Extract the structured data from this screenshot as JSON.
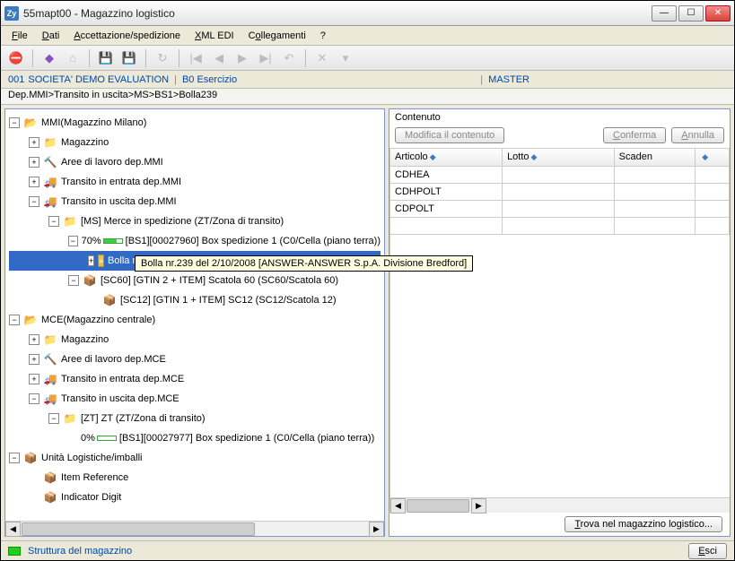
{
  "window": {
    "title": "55mapt00 - Magazzino logistico"
  },
  "menu": {
    "file": "File",
    "dati": "Dati",
    "accett": "Accettazione/spedizione",
    "xml": "XML EDI",
    "coll": "Collegamenti",
    "help": "?"
  },
  "infobar": {
    "code": "001",
    "company": "SOCIETA' DEMO EVALUATION",
    "bo": "B0 Esercizio",
    "master": "MASTER"
  },
  "path": "Dep.MMI>Transito in uscita>MS>BS1>Bolla239",
  "tree": {
    "n1": "MMI(Magazzino Milano)",
    "n2": "Magazzino",
    "n3": "Aree di lavoro dep.MMI",
    "n4": "Transito in entrata dep.MMI",
    "n5": "Transito in uscita dep.MMI",
    "n6": "[MS] Merce in spedizione (ZT/Zona di transito)",
    "p70": "70%",
    "n7": "[BS1][00027960]  Box spedizione 1 (C0/Cella (piano terra))",
    "n8": "Bolla nr.239 del  2/10/2008 [ANSWER-ANSWER S.p.A. Divisione Bredford]",
    "n9": "[SC60] [GTIN 2 + ITEM]  Scatola 60 (SC60/Scatola 60)",
    "n10": "[SC12] [GTIN 1 + ITEM]  SC12 (SC12/Scatola 12)",
    "n11": "MCE(Magazzino centrale)",
    "n12": "Magazzino",
    "n13": "Aree di lavoro dep.MCE",
    "n14": "Transito in entrata dep.MCE",
    "n15": "Transito in uscita dep.MCE",
    "n16": "[ZT] ZT (ZT/Zona di transito)",
    "p0": "0%",
    "n17": "[BS1][00027977]  Box spedizione 1 (C0/Cella (piano terra))",
    "n18": "Unità Logistiche/imballi",
    "n19": "Item Reference",
    "n20": "Indicator Digit"
  },
  "tooltip": "Bolla nr.239 del  2/10/2008 [ANSWER-ANSWER S.p.A. Divisione Bredford]",
  "right": {
    "header": "Contenuto",
    "modify": "Modifica il contenuto",
    "confirm": "Conferma",
    "cancel": "Annulla",
    "cols": {
      "c1": "Articolo",
      "c2": "Lotto",
      "c3": "Scaden"
    },
    "rows": {
      "r1": "CDHEA",
      "r2": "CDHPOLT",
      "r3": "CDPOLT"
    },
    "find": "Trova nel magazzino logistico..."
  },
  "status": {
    "text": "Struttura del magazzino",
    "exit": "Esci"
  }
}
